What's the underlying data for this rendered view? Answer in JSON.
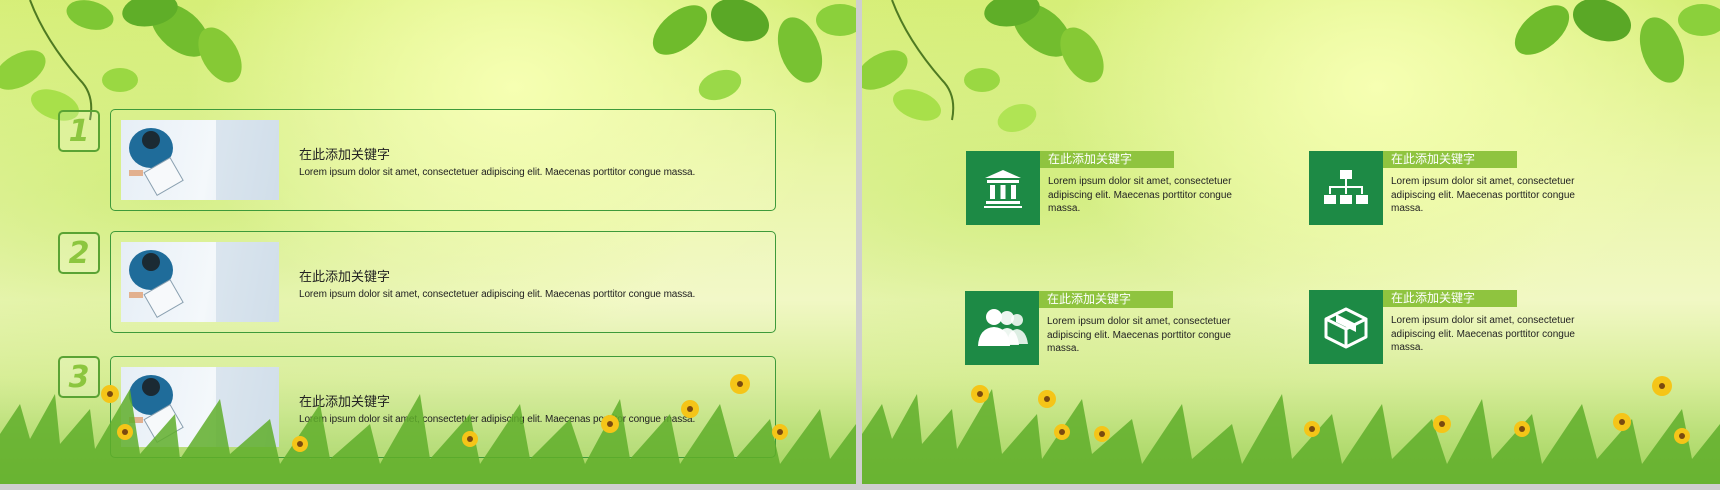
{
  "left_slide": {
    "items": [
      {
        "number": "1",
        "title": "在此添加关键字",
        "text": "Lorem ipsum dolor sit amet, consectetuer adipiscing elit. Maecenas porttitor congue massa."
      },
      {
        "number": "2",
        "title": "在此添加关键字",
        "text": "Lorem ipsum dolor sit amet, consectetuer adipiscing elit. Maecenas porttitor congue massa."
      },
      {
        "number": "3",
        "title": "在此添加关键字",
        "text": "Lorem ipsum dolor sit amet, consectetuer adipiscing elit. Maecenas porttitor congue massa."
      }
    ]
  },
  "right_slide": {
    "features": [
      {
        "icon": "bank-icon",
        "title": "在此添加关键字",
        "text": "Lorem ipsum dolor sit amet, consectetuer adipiscing elit. Maecenas porttitor congue massa."
      },
      {
        "icon": "org-chart-icon",
        "title": "在此添加关键字",
        "text": "Lorem ipsum dolor sit amet, consectetuer adipiscing elit. Maecenas porttitor congue massa."
      },
      {
        "icon": "users-icon",
        "title": "在此添加关键字",
        "text": "Lorem ipsum dolor sit amet, consectetuer adipiscing elit. Maecenas porttitor congue massa."
      },
      {
        "icon": "box-icon",
        "title": "在此添加关键字",
        "text": "Lorem ipsum dolor sit amet, consectetuer adipiscing elit. Maecenas porttitor congue massa."
      }
    ]
  },
  "colors": {
    "dark_green": "#1d8a45",
    "light_green": "#8fc43f",
    "number_green": "#8cc63f",
    "border_green": "#3e9a3a"
  }
}
